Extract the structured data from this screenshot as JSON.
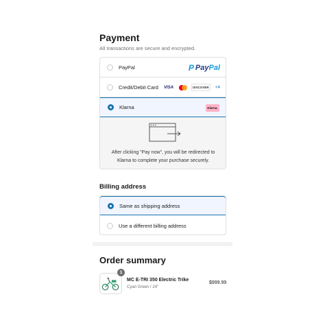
{
  "payment": {
    "title": "Payment",
    "subtitle": "All transactions are secure and encrypted.",
    "options": [
      {
        "label": "PayPal",
        "selected": false,
        "logo": "paypal-logo"
      },
      {
        "label": "Credit/Debit Card",
        "selected": false,
        "logo": "card-logos"
      },
      {
        "label": "Klarna",
        "selected": true,
        "logo": "klarna-logo"
      }
    ],
    "paypal_logo_text_a": "Pay",
    "paypal_logo_text_b": "Pal",
    "paypal_mark": "P",
    "cards": {
      "visa": "VISA",
      "discover": "DISCOVER",
      "more": "+4"
    },
    "klarna_badge": "Klarna.",
    "redirect_text": "After clicking \"Pay now\", you will be redirected to Klarna to complete your purchase securely."
  },
  "billing": {
    "title": "Billing address",
    "options": [
      {
        "label": "Same as shipping address",
        "selected": true
      },
      {
        "label": "Use a different billing address",
        "selected": false
      }
    ]
  },
  "order": {
    "title": "Order summary",
    "item": {
      "quantity": "1",
      "name": "MC E-TRI 350 Electric Trike",
      "variant": "Cyan Green / 24\"",
      "price": "$999.99",
      "thumbnail_icon": "trike-icon"
    }
  },
  "colors": {
    "accent": "#1773b0",
    "selected_bg": "#f0f5ff",
    "klarna_pink": "#ffb3c7",
    "paypal_blue": "#253b80",
    "paypal_light": "#179bd7"
  }
}
